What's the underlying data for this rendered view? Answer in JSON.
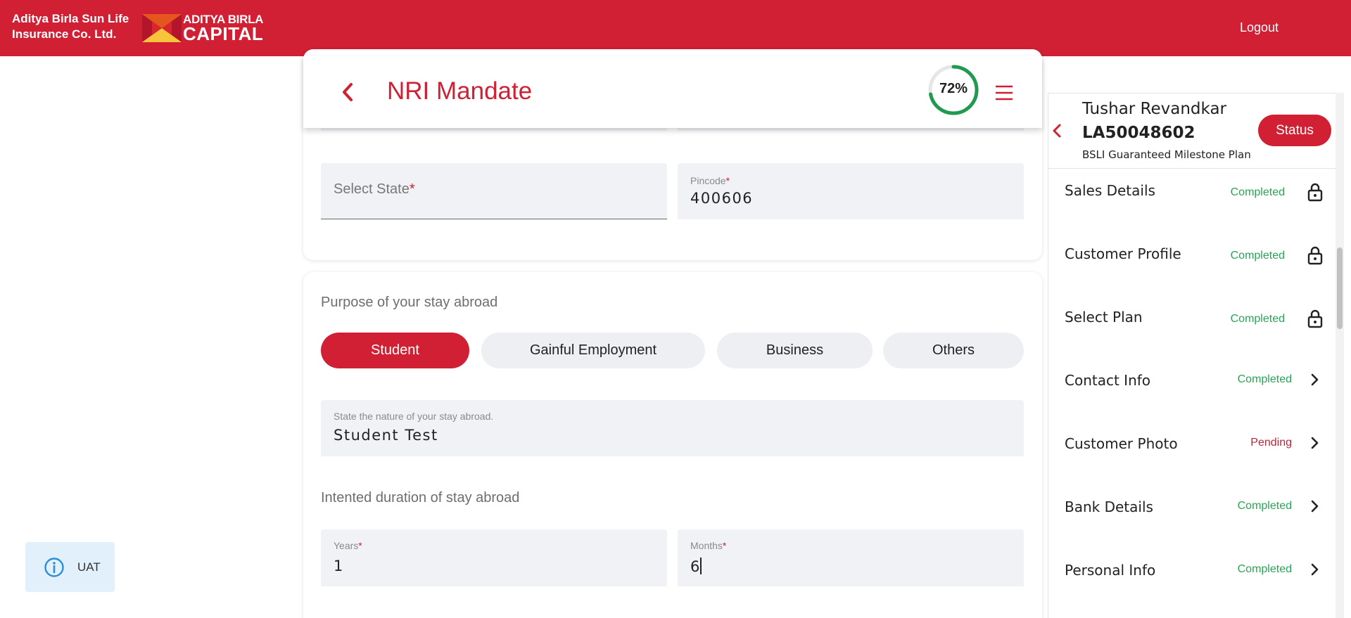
{
  "header": {
    "brand_line1": "Aditya Birla Sun Life",
    "brand_line2": "Insurance Co. Ltd.",
    "logo_line1": "ADITYA BIRLA",
    "logo_line2": "CAPITAL",
    "logout": "Logout",
    "brand_color": "#d11f34"
  },
  "page": {
    "title": "NRI Mandate",
    "progress_text": "72%",
    "progress_value": 0.72
  },
  "address": {
    "state_placeholder": "Select State",
    "pincode_label": "Pincode",
    "pincode_value": "400606",
    "required_mark": "*"
  },
  "purpose": {
    "label": "Purpose of your stay abroad",
    "options": [
      "Student",
      "Gainful Employment",
      "Business",
      "Others"
    ],
    "selected": "Student",
    "nature_label": "State the nature of your stay abroad.",
    "nature_value": "Student Test"
  },
  "duration": {
    "label": "Intented duration of stay abroad",
    "years_label": "Years",
    "years_value": "1",
    "months_label": "Months",
    "months_value": "6"
  },
  "env_badge": "UAT",
  "side_panel": {
    "customer_name": "Tushar Revandkar",
    "application_id": "LA50048602",
    "plan_name": "BSLI Guaranteed Milestone Plan",
    "status_button": "Status",
    "items": [
      {
        "label": "Sales Details",
        "status": "Completed",
        "icon": "lock-icon"
      },
      {
        "label": "Customer Profile",
        "status": "Completed",
        "icon": "lock-icon"
      },
      {
        "label": "Select Plan",
        "status": "Completed",
        "icon": "lock-icon"
      },
      {
        "label": "Contact Info",
        "status": "Completed",
        "icon": "chevron-right-icon"
      },
      {
        "label": "Customer Photo",
        "status": "Pending",
        "icon": "chevron-right-icon"
      },
      {
        "label": "Bank Details",
        "status": "Completed",
        "icon": "chevron-right-icon"
      },
      {
        "label": "Personal Info",
        "status": "Completed",
        "icon": "chevron-right-icon"
      }
    ]
  }
}
